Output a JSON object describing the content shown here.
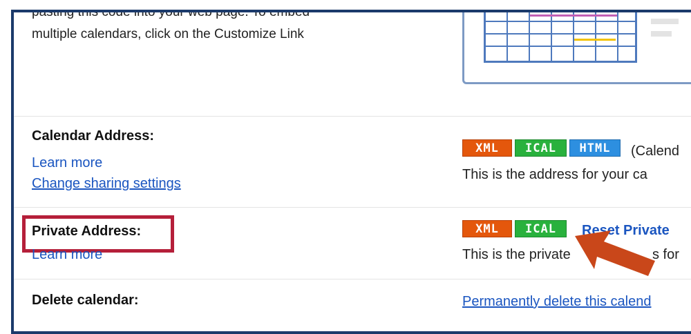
{
  "intro": {
    "line1": "pasting this code into your web page. To embed",
    "line2": "multiple calendars, click on the Customize Link"
  },
  "calendar_address": {
    "label": "Calendar Address:",
    "learn_more": "Learn more",
    "change_sharing": "Change sharing settings",
    "badges": [
      "XML",
      "ICAL",
      "HTML"
    ],
    "note": "(Calend",
    "description": "This is the address for your ca"
  },
  "private_address": {
    "label": "Private Address:",
    "learn_more": "Learn more",
    "badges": [
      "XML",
      "ICAL"
    ],
    "reset_link": "Reset Private",
    "description_a": "This is the private",
    "description_b": "s for"
  },
  "delete_calendar": {
    "label": "Delete calendar:",
    "link": "Permanently delete this calend"
  },
  "colors": {
    "xml": "#e4570c",
    "ical": "#29b13d",
    "html": "#2d8fe0",
    "highlight": "#b51f3a",
    "arrow": "#c9471a",
    "frame": "#1b3a6b"
  }
}
